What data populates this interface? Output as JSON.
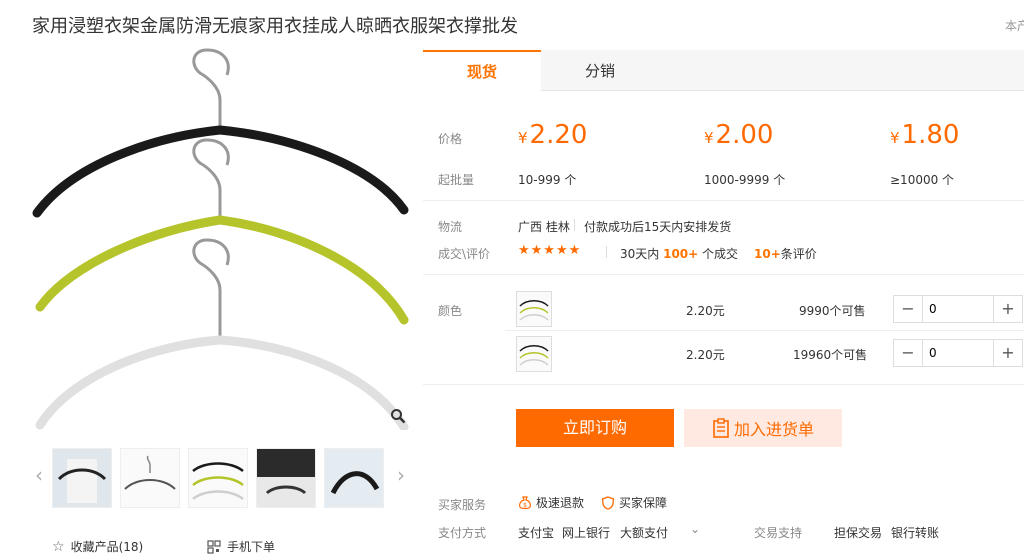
{
  "title": "家用浸塑衣架金属防滑无痕家用衣挂成人晾晒衣服架衣撑批发",
  "corner_note": "本产",
  "tabs": [
    {
      "label": "现货"
    },
    {
      "label": "分销"
    }
  ],
  "pricing": {
    "price_label": "价格",
    "moq_label": "起批量",
    "currency": "¥",
    "tiers": [
      {
        "price": "2.20",
        "range": "10-999 个"
      },
      {
        "price": "2.00",
        "range": "1000-9999 个"
      },
      {
        "price": "1.80",
        "range": "≥10000 个"
      }
    ]
  },
  "logistics": {
    "label": "物流",
    "origin": "广西 桂林",
    "shipping": "付款成功后15天内安排发货"
  },
  "deals": {
    "label": "成交\\评价",
    "stars": "★★★★★",
    "rating": 5,
    "sold_prefix": "30天内",
    "sold_count": "100+",
    "sold_suffix": "个成交",
    "review_count": "10+",
    "review_suffix": "条评价"
  },
  "colors": {
    "label": "颜色",
    "options": [
      {
        "price": "2.20元",
        "stock": "9990个可售",
        "quantity": "0"
      },
      {
        "price": "2.20元",
        "stock": "19960个可售",
        "quantity": "0"
      }
    ]
  },
  "actions": {
    "buy_now": "立即订购",
    "add_to_list": "加入进货单"
  },
  "services": {
    "label": "买家服务",
    "items": [
      "极速退款",
      "买家保障"
    ]
  },
  "payment": {
    "label": "支付方式",
    "methods": [
      "支付宝",
      "网上银行",
      "大额支付"
    ],
    "trade_support_label": "交易支持",
    "trade_support_items": [
      "担保交易",
      "银行转账"
    ]
  },
  "footer": {
    "favorite": "收藏产品(18)",
    "mobile_order": "手机下单"
  },
  "icons": {
    "zoom": "magnifier-icon",
    "favorite": "star-outline-icon",
    "mobile": "qr-code-icon",
    "cart": "clipboard-icon",
    "refund": "money-bag-icon",
    "guarantee": "shield-icon"
  },
  "accent_color": "#ff6a00",
  "hanger_colors": [
    "#1a1a1a",
    "#b5c42a",
    "#e6e6e6"
  ]
}
